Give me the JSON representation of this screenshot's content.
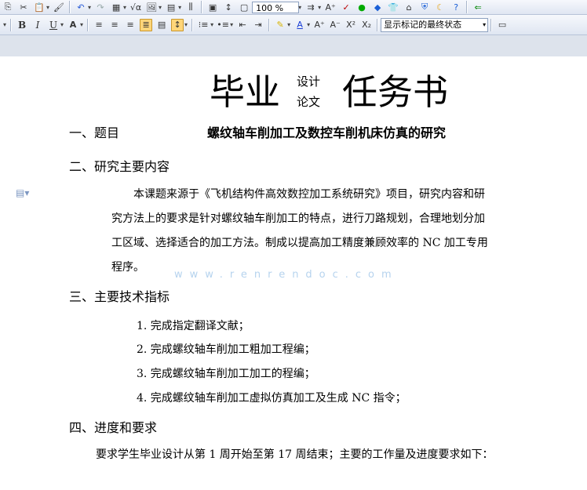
{
  "toolbar": {
    "zoom": "100 %",
    "markup_view": "显示标记的最终状态"
  },
  "document": {
    "title_left": "毕业",
    "title_mid_top": "设计",
    "title_mid_bottom": "论文",
    "title_right": "任务书",
    "section1_heading": "一、题目",
    "subject": "螺纹轴车削加工及数控车削机床仿真的研究",
    "section2_heading": "二、研究主要内容",
    "content_lines": [
      "　　本课题来源于《飞机结构件高效数控加工系统研究》项目，研究内容和研",
      "究方法上的要求是针对螺纹轴车削加工的特点，进行刀路规划，合理地划分加",
      "工区域、选择适合的加工方法。制成以提高加工精度兼顾效率的 NC 加工专用",
      "程序。"
    ],
    "section3_heading": "三、主要技术指标",
    "tech_items": [
      "1. 完成指定翻译文献；",
      "2. 完成螺纹轴车削加工粗加工程编；",
      "3. 完成螺纹轴车削加工加工的程编；",
      "4. 完成螺纹轴车削加工虚拟仿真加工及生成 NC 指令；"
    ],
    "section4_heading": "四、进度和要求",
    "requirement": "要求学生毕业设计从第 1 周开始至第 17 周结束；主要的工作量及进度要求如下："
  },
  "watermark": "www.renrendoc.com"
}
